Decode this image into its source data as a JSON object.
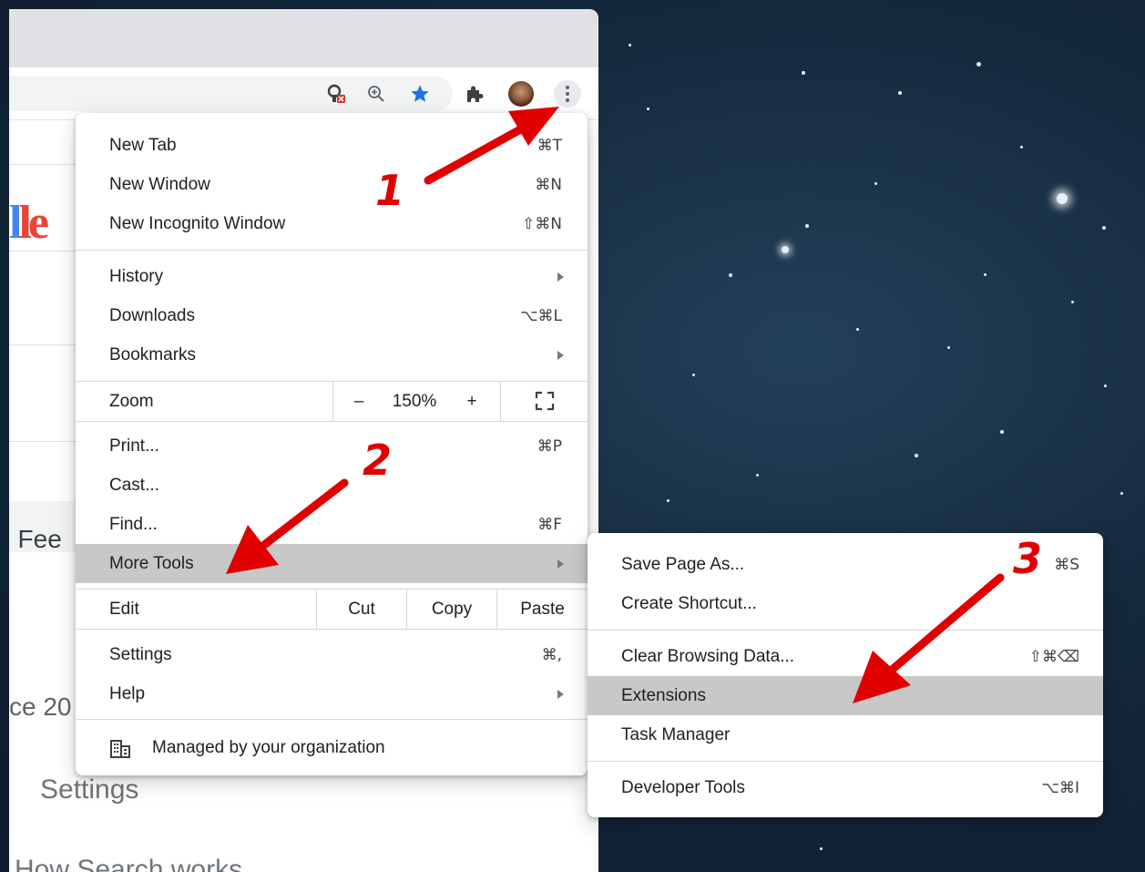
{
  "colors": {
    "accent_star": "#1a73e8",
    "annotation_red": "#e00000",
    "highlight": "#c8c8c8"
  },
  "toolbar": {
    "icons": [
      "key-blocked-icon",
      "zoom-in-icon",
      "bookmark-star-icon",
      "extensions-puzzle-icon",
      "avatar",
      "three-dot-menu-icon"
    ]
  },
  "page_background": {
    "logo_fragment": "le",
    "feeling_fragment": "ı Fee",
    "since_fragment": "ce 20",
    "settings_text": "Settings",
    "bottom_fragment": "How Search works"
  },
  "menu": {
    "group1": [
      {
        "label": "New Tab",
        "shortcut": "⌘T"
      },
      {
        "label": "New Window",
        "shortcut": "⌘N"
      },
      {
        "label": "New Incognito Window",
        "shortcut": "⇧⌘N"
      }
    ],
    "group2": [
      {
        "label": "History",
        "submenu": true
      },
      {
        "label": "Downloads",
        "shortcut": "⌥⌘L"
      },
      {
        "label": "Bookmarks",
        "submenu": true
      }
    ],
    "zoom": {
      "label": "Zoom",
      "minus": "–",
      "value": "150%",
      "plus": "+"
    },
    "group3": [
      {
        "label": "Print...",
        "shortcut": "⌘P"
      },
      {
        "label": "Cast..."
      },
      {
        "label": "Find...",
        "shortcut": "⌘F"
      },
      {
        "label": "More Tools",
        "submenu": true,
        "highlighted": true
      }
    ],
    "edit": {
      "label": "Edit",
      "cut": "Cut",
      "copy": "Copy",
      "paste": "Paste"
    },
    "group4": [
      {
        "label": "Settings",
        "shortcut": "⌘,"
      },
      {
        "label": "Help",
        "submenu": true
      }
    ],
    "managed": {
      "label": "Managed by your organization"
    }
  },
  "submenu": {
    "group1": [
      {
        "label": "Save Page As...",
        "shortcut": "⌘S"
      },
      {
        "label": "Create Shortcut..."
      }
    ],
    "group2": [
      {
        "label": "Clear Browsing Data...",
        "shortcut": "⇧⌘⌫"
      },
      {
        "label": "Extensions",
        "highlighted": true
      },
      {
        "label": "Task Manager"
      }
    ],
    "group3": [
      {
        "label": "Developer Tools",
        "shortcut": "⌥⌘I"
      }
    ]
  },
  "annotations": {
    "step1": "1",
    "step2": "2",
    "step3": "3"
  }
}
